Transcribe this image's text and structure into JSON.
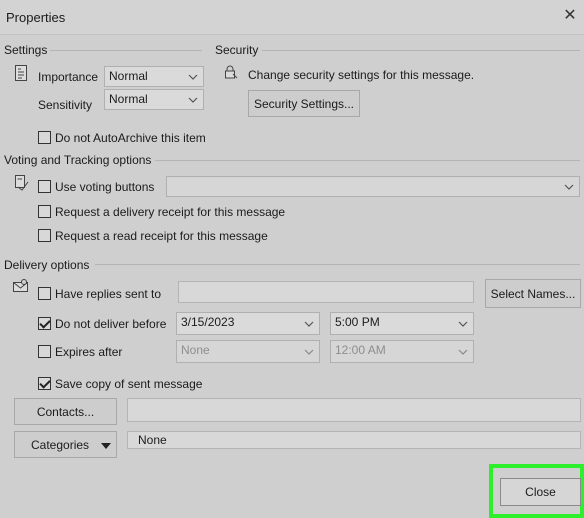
{
  "window": {
    "title": "Properties",
    "close_glyph": "✕"
  },
  "settings": {
    "heading": "Settings",
    "importance": {
      "label": "Importance",
      "value": "Normal"
    },
    "sensitivity": {
      "label": "Sensitivity",
      "value": "Normal"
    },
    "autoarchive": {
      "label": "Do not AutoArchive this item",
      "checked": false
    }
  },
  "security": {
    "heading": "Security",
    "description": "Change security settings for this message.",
    "button_label": "Security Settings..."
  },
  "voting": {
    "heading": "Voting and Tracking options",
    "use_voting": {
      "label": "Use voting buttons",
      "checked": false,
      "value": ""
    },
    "delivery_receipt": {
      "label": "Request a delivery receipt for this message",
      "checked": false
    },
    "read_receipt": {
      "label": "Request a read receipt for this message",
      "checked": false
    }
  },
  "delivery": {
    "heading": "Delivery options",
    "replies": {
      "label": "Have replies sent to",
      "checked": false,
      "value": ""
    },
    "select_names_label": "Select Names...",
    "do_not_deliver": {
      "label": "Do not deliver before",
      "checked": true,
      "date": "3/15/2023",
      "time": "5:00 PM"
    },
    "expires": {
      "label": "Expires after",
      "checked": false,
      "date": "None",
      "time": "12:00 AM"
    },
    "save_copy": {
      "label": "Save copy of sent message",
      "checked": true
    },
    "contacts_label": "Contacts...",
    "contacts_value": "",
    "categories_label": "Categories",
    "categories_value": "None"
  },
  "footer": {
    "close_label": "Close"
  },
  "colors": {
    "highlight": "#2df02d",
    "background": "#cfcfcf"
  }
}
